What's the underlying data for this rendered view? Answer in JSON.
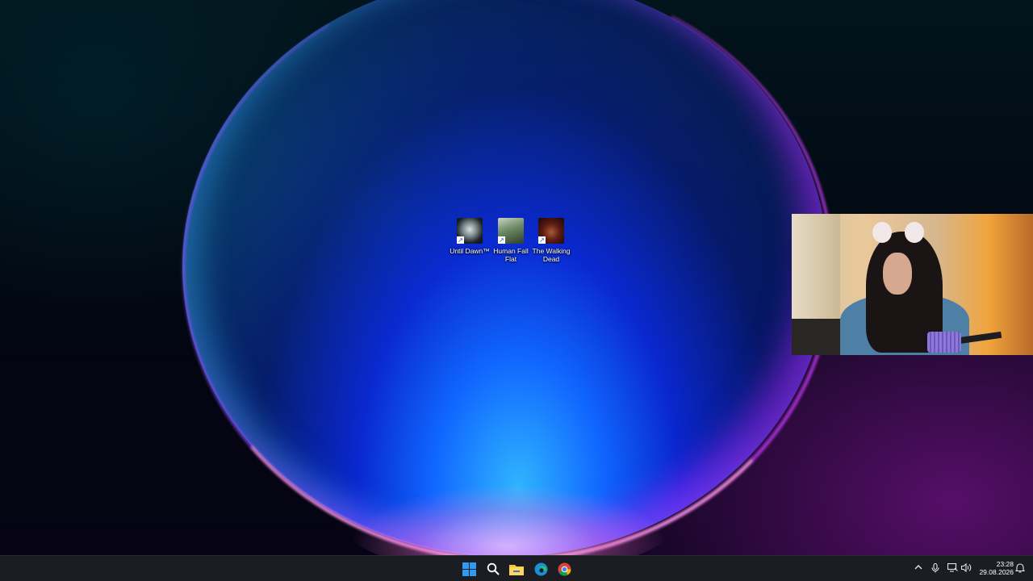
{
  "desktop": {
    "icons": [
      {
        "label": "Until Dawn™",
        "icon": "skull-game-icon"
      },
      {
        "label": "Human Fall Flat",
        "icon": "human-fall-flat-game-icon"
      },
      {
        "label": "The Walking Dead",
        "icon": "zombie-game-icon"
      }
    ]
  },
  "taskbar": {
    "apps": [
      {
        "name": "Start",
        "icon": "windows-start-icon"
      },
      {
        "name": "Search",
        "icon": "search-icon"
      },
      {
        "name": "File Explorer",
        "icon": "folder-icon"
      },
      {
        "name": "Microsoft Edge",
        "icon": "edge-icon"
      },
      {
        "name": "Google Chrome",
        "icon": "chrome-icon"
      }
    ],
    "tray": {
      "icons": [
        "chevron-up-icon",
        "microphone-icon",
        "network-icon",
        "volume-icon",
        "notification-icon"
      ],
      "time": "23:28",
      "date": "29.08.2026"
    }
  },
  "colors": {
    "taskbar_bg": "#1c1d22",
    "start_blue": "#2e9bf0",
    "folder_yellow": "#f3c33c"
  }
}
